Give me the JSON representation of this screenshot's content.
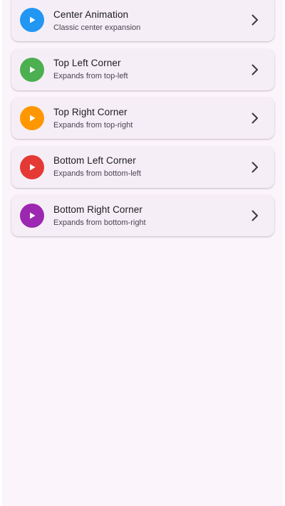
{
  "items": [
    {
      "title": "Center Animation",
      "subtitle": "Classic center expansion",
      "icon": "play-icon",
      "color": "#2196f3"
    },
    {
      "title": "Top Left Corner",
      "subtitle": "Expands from top-left",
      "icon": "play-icon",
      "color": "#4caf50"
    },
    {
      "title": "Top Right Corner",
      "subtitle": "Expands from top-right",
      "icon": "play-icon",
      "color": "#ff9800"
    },
    {
      "title": "Bottom Left Corner",
      "subtitle": "Expands from bottom-left",
      "icon": "play-icon",
      "color": "#e53935"
    },
    {
      "title": "Bottom Right Corner",
      "subtitle": "Expands from bottom-right",
      "icon": "play-icon",
      "color": "#9c27b0"
    }
  ],
  "trailing_icon": "chevron-right-icon"
}
